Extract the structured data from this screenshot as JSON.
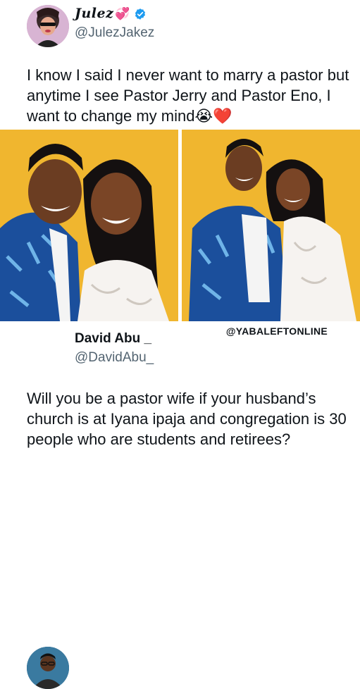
{
  "tweet1": {
    "display_name": "Julez",
    "name_emoji": "💞",
    "handle": "@JulezJakez",
    "text": "I know I said I never want to marry a pastor but anytime I see Pastor Jerry and Pastor Eno, I want to change my mind😭❤️"
  },
  "tweet2": {
    "display_name": "David Abu _",
    "handle": "@DavidAbu_",
    "text": "Will you be a pastor wife if your husband’s church is at Iyana ipaja and congregation is 30 people who are students and retirees?"
  },
  "watermark": "@YABALEFTONLINE",
  "colors": {
    "verified": "#1d9bf0",
    "photo_background": "#f0b62f",
    "handle": "#536471",
    "text": "#0f1419"
  },
  "icons": [
    "verified-badge-icon",
    "hearts-emoji-icon"
  ]
}
